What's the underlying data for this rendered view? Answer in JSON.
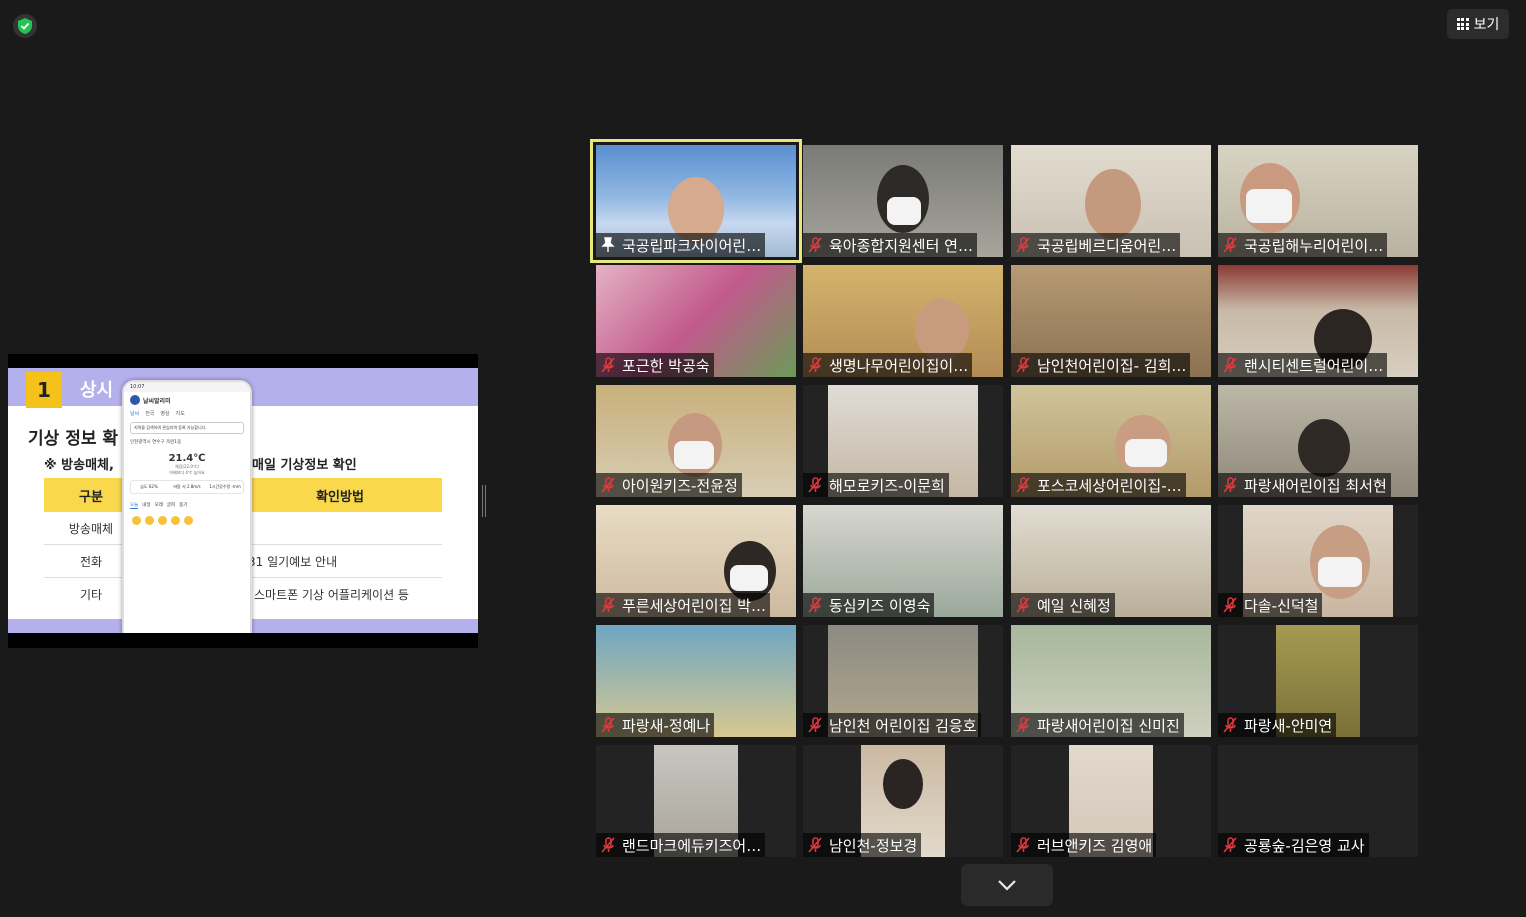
{
  "top_right": {
    "view_label": "보기"
  },
  "slide": {
    "number": "1",
    "title": "상시",
    "subtitle": "기상 정보 확",
    "note_left": "※ 방송매체,",
    "note_right": "매일 기상정보 확인",
    "col1_header": "구분",
    "col2_header": "확인방법",
    "rows": [
      {
        "type": "방송매체",
        "method": ""
      },
      {
        "type": "전화",
        "method": "31 일기예보 안내"
      },
      {
        "type": "기타",
        "method": "스마트폰 기상 어플리케이션 등"
      }
    ]
  },
  "phone": {
    "status_time": "10:07",
    "app_name": "날씨알리미",
    "tabs": [
      "날씨",
      "전국",
      "영상",
      "지도"
    ],
    "search_placeholder": "지역을 검색하여 관심지역 등록 가능합니다.",
    "location": "인천광역시 연수구 옥련1동",
    "temperature": "21.4℃",
    "feels": "체감(22.0℃)",
    "compare": "어제보다 4℃ 높아요",
    "stats": [
      "습도 62%",
      "바람 서 2.8m/s",
      "1시간강수량 -mm"
    ],
    "forecast_tabs": [
      "오늘",
      "내일",
      "모레",
      "글피",
      "중기"
    ],
    "active_forecast_tab": "오늘"
  },
  "participants": [
    {
      "name": "국공립파크자이어린…",
      "muted": false,
      "pinned": true,
      "active": true
    },
    {
      "name": "육아종합지원센터 연…",
      "muted": true
    },
    {
      "name": "국공립베르디움어린…",
      "muted": true
    },
    {
      "name": "국공립해누리어린이…",
      "muted": true
    },
    {
      "name": "포근한 박공숙",
      "muted": true
    },
    {
      "name": "생명나무어린이집이…",
      "muted": true
    },
    {
      "name": "남인천어린이집- 김희…",
      "muted": true
    },
    {
      "name": "랜시티센트럴어린이…",
      "muted": true
    },
    {
      "name": "아이원키즈-전윤정",
      "muted": true
    },
    {
      "name": "해모로키즈-이문희",
      "muted": true
    },
    {
      "name": "포스코세상어린이집-…",
      "muted": true
    },
    {
      "name": "파랑새어린이집 최서현",
      "muted": true
    },
    {
      "name": "푸른세상어린이집 박…",
      "muted": true
    },
    {
      "name": "동심키즈 이영숙",
      "muted": true
    },
    {
      "name": "예일 신혜정",
      "muted": true
    },
    {
      "name": "다솔-신덕철",
      "muted": true
    },
    {
      "name": "파랑새-정예나",
      "muted": true
    },
    {
      "name": "남인천 어린이집 김응호",
      "muted": true
    },
    {
      "name": "파랑새어린이집 신미진",
      "muted": true
    },
    {
      "name": "파랑새-안미연",
      "muted": true
    },
    {
      "name": "랜드마크에듀키즈어…",
      "muted": true
    },
    {
      "name": "남인천-정보경",
      "muted": true
    },
    {
      "name": "러브앤키즈 김영애",
      "muted": true
    },
    {
      "name": "공룡숲-김은영 교사",
      "muted": true
    }
  ],
  "colors": {
    "active_border": "#e7e77e",
    "mute_red": "#e0393e",
    "background": "#1a1a1a"
  }
}
